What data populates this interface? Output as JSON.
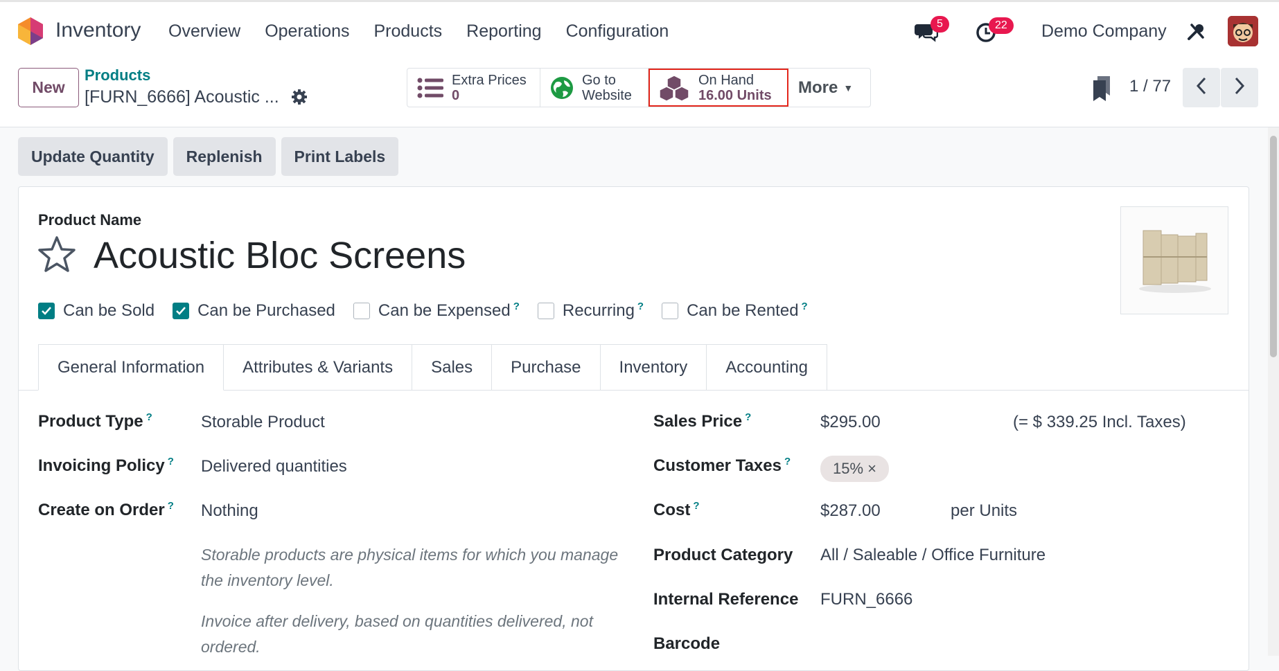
{
  "navbar": {
    "app_name": "Inventory",
    "menu": [
      "Overview",
      "Operations",
      "Products",
      "Reporting",
      "Configuration"
    ],
    "chat_count": "5",
    "activity_count": "22",
    "company": "Demo Company"
  },
  "control": {
    "new_label": "New",
    "breadcrumb": "Products",
    "record_title": "[FURN_6666] Acoustic ...",
    "smart_buttons": [
      {
        "label": "Extra Prices",
        "value": "0"
      },
      {
        "label": "Go to",
        "label2": "Website"
      },
      {
        "label": "On Hand",
        "value": "16.00 Units"
      },
      {
        "label": "More"
      }
    ],
    "pager": "1 / 77"
  },
  "actions": [
    "Update Quantity",
    "Replenish",
    "Print Labels"
  ],
  "form": {
    "product_name_label": "Product Name",
    "product_name": "Acoustic Bloc Screens",
    "checks": [
      {
        "label": "Can be Sold",
        "checked": true,
        "help": ""
      },
      {
        "label": "Can be Purchased",
        "checked": true,
        "help": ""
      },
      {
        "label": "Can be Expensed",
        "checked": false,
        "help": "?"
      },
      {
        "label": "Recurring",
        "checked": false,
        "help": "?"
      },
      {
        "label": "Can be Rented",
        "checked": false,
        "help": "?"
      }
    ],
    "tabs": [
      "General Information",
      "Attributes & Variants",
      "Sales",
      "Purchase",
      "Inventory",
      "Accounting"
    ],
    "left_fields": [
      {
        "label": "Product Type",
        "value": "Storable Product"
      },
      {
        "label": "Invoicing Policy",
        "value": "Delivered quantities"
      },
      {
        "label": "Create on Order",
        "value": "Nothing"
      }
    ],
    "help_text_1": "Storable products are physical items for which you manage the inventory level.",
    "help_text_2": "Invoice after delivery, based on quantities delivered, not ordered.",
    "right_fields": {
      "sales_price_label": "Sales Price",
      "sales_price": "$295.00",
      "incl_taxes": "(= $ 339.25 Incl. Taxes)",
      "customer_taxes_label": "Customer Taxes",
      "tax_tag": "15% ×",
      "cost_label": "Cost",
      "cost": "$287.00",
      "cost_unit": "per Units",
      "category_label": "Product Category",
      "category": "All / Saleable / Office Furniture",
      "internal_ref_label": "Internal Reference",
      "internal_ref": "FURN_6666",
      "barcode_label": "Barcode"
    },
    "help_mark": "?"
  },
  "colors": {
    "accent": "#714b67",
    "teal": "#017e84",
    "badge": "#e8184f",
    "highlight": "#e3261b"
  }
}
